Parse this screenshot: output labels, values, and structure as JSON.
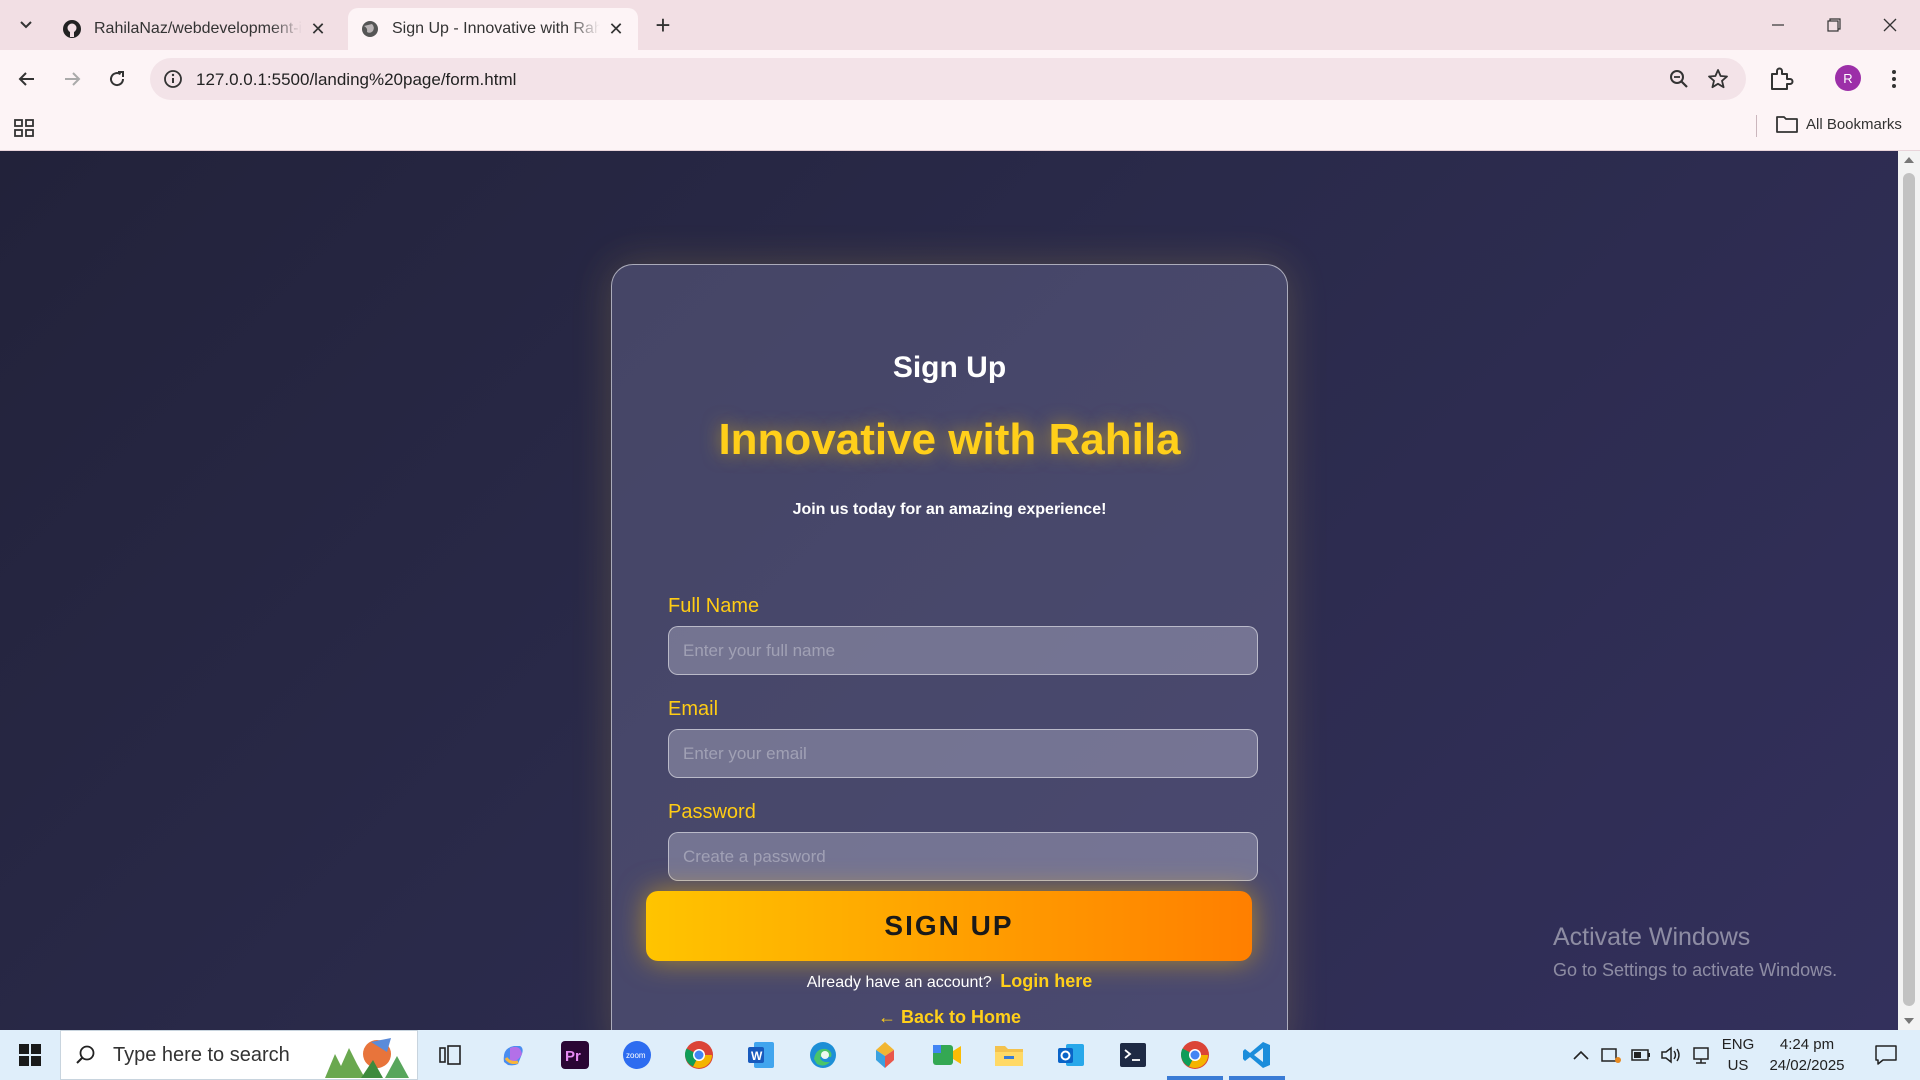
{
  "browser": {
    "tabs": [
      {
        "title": "RahilaNaz/webdevelopment-intern",
        "active": false,
        "favicon": "github-icon"
      },
      {
        "title": "Sign Up - Innovative with Rahila",
        "active": true,
        "favicon": "globe-icon"
      }
    ],
    "url": "127.0.0.1:5500/landing%20page/form.html",
    "profile_initial": "R",
    "all_bookmarks": "All Bookmarks"
  },
  "page": {
    "heading": "Sign Up",
    "brand": "Innovative with Rahila",
    "tagline": "Join us today for an amazing experience!",
    "fields": {
      "full_name": {
        "label": "Full Name",
        "placeholder": "Enter your full name",
        "value": ""
      },
      "email": {
        "label": "Email",
        "placeholder": "Enter your email",
        "value": ""
      },
      "password": {
        "label": "Password",
        "placeholder": "Create a password",
        "value": ""
      }
    },
    "submit_label": "SIGN UP",
    "login_prompt": "Already have an account?",
    "login_link": "Login here",
    "back_link": "← Back to Home",
    "accent_color": "#ffcf1a"
  },
  "watermark": {
    "line1": "Activate Windows",
    "line2": "Go to Settings to activate Windows."
  },
  "taskbar": {
    "search_placeholder": "Type here to search",
    "apps": [
      "task-view-icon",
      "copilot-icon",
      "premiere-pro-icon",
      "zoom-icon",
      "chrome-icon",
      "word-icon",
      "edge-icon",
      "vs-app-icon",
      "meet-icon",
      "file-explorer-icon",
      "outlook-icon",
      "terminal-icon",
      "chrome-active-icon",
      "vscode-icon"
    ],
    "lang_line1": "ENG",
    "lang_line2": "US",
    "time": "4:24 pm",
    "date": "24/02/2025"
  }
}
